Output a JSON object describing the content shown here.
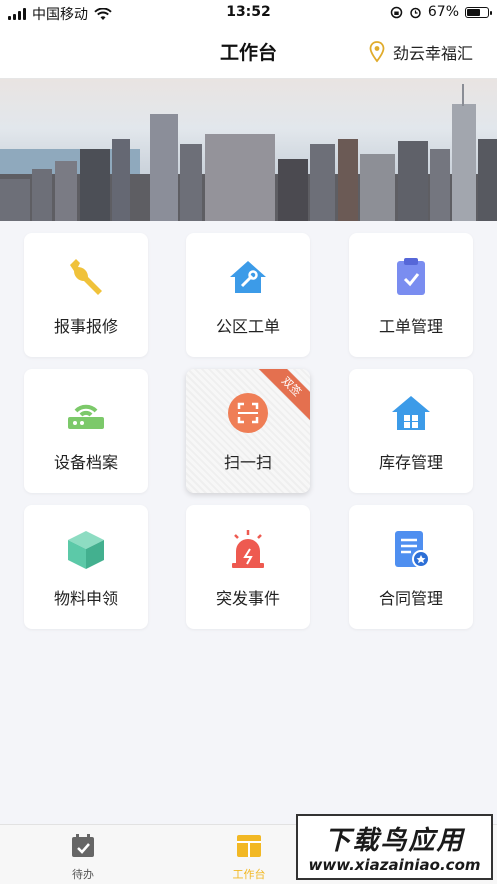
{
  "status_bar": {
    "carrier": "中国移动",
    "time": "13:52",
    "battery": "67%",
    "battery_level": 0.67
  },
  "header": {
    "title": "工作台",
    "location": "劲云幸福汇"
  },
  "tiles": [
    {
      "label": "报事报修",
      "icon": "wrench-icon",
      "color": "#f0c23a"
    },
    {
      "label": "公区工单",
      "icon": "house-wrench-icon",
      "color": "#3c9be8"
    },
    {
      "label": "工单管理",
      "icon": "clipboard-icon",
      "color": "#7a8df0"
    },
    {
      "label": "设备档案",
      "icon": "router-icon",
      "color": "#7cc96a"
    },
    {
      "label": "扫一扫",
      "icon": "scan-icon",
      "color": "#ef7e56",
      "badge": "双签"
    },
    {
      "label": "库存管理",
      "icon": "warehouse-icon",
      "color": "#3c9be8"
    },
    {
      "label": "物料申领",
      "icon": "box-icon",
      "color": "#5cc9a8"
    },
    {
      "label": "突发事件",
      "icon": "alarm-icon",
      "color": "#ee5a50"
    },
    {
      "label": "合同管理",
      "icon": "contract-icon",
      "color": "#4f8ff0"
    }
  ],
  "tabbar": {
    "tabs": [
      {
        "label": "待办",
        "icon": "todo-calendar-icon",
        "color": "#555555"
      },
      {
        "label": "工作台",
        "icon": "workbench-icon",
        "color": "#f2b824"
      }
    ]
  },
  "watermark": {
    "line1": "下载鸟应用",
    "line2": "www.xiazainiao.com"
  }
}
